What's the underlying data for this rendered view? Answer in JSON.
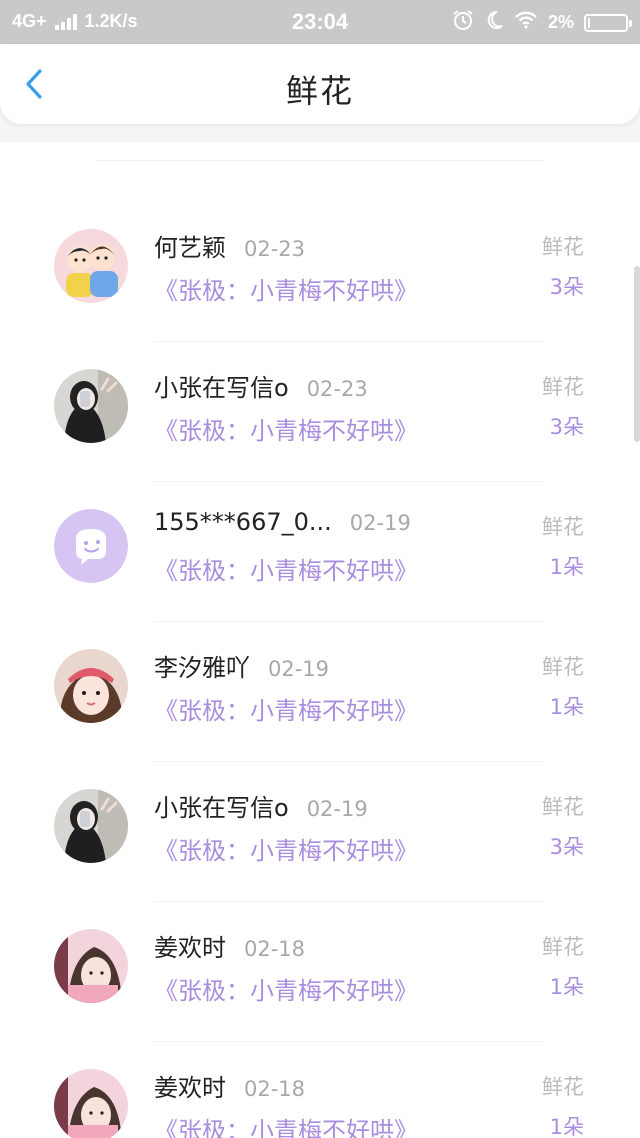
{
  "status_bar": {
    "network": "4G+",
    "speed": "1.2K/s",
    "time": "23:04",
    "battery": "2%"
  },
  "header": {
    "title": "鲜花"
  },
  "colors": {
    "accent": "#a98de0",
    "back_arrow": "#3a9fe8",
    "status_bar_bg": "#c9c9cc"
  },
  "records": [
    {
      "name": "何艺颖",
      "date": "02-23",
      "book": "《张极：小青梅不好哄》",
      "type": "鲜花",
      "count": "3朵"
    },
    {
      "name": "小张在写信o",
      "date": "02-23",
      "book": "《张极：小青梅不好哄》",
      "type": "鲜花",
      "count": "3朵"
    },
    {
      "name": "155***667_0...",
      "date": "02-19",
      "book": "《张极：小青梅不好哄》",
      "type": "鲜花",
      "count": "1朵"
    },
    {
      "name": "李汐雅吖",
      "date": "02-19",
      "book": "《张极：小青梅不好哄》",
      "type": "鲜花",
      "count": "1朵"
    },
    {
      "name": "小张在写信o",
      "date": "02-19",
      "book": "《张极：小青梅不好哄》",
      "type": "鲜花",
      "count": "3朵"
    },
    {
      "name": "姜欢时",
      "date": "02-18",
      "book": "《张极：小青梅不好哄》",
      "type": "鲜花",
      "count": "1朵"
    },
    {
      "name": "姜欢时",
      "date": "02-18",
      "book": "《张极：小青梅不好哄》",
      "type": "鲜花",
      "count": "1朵"
    }
  ]
}
